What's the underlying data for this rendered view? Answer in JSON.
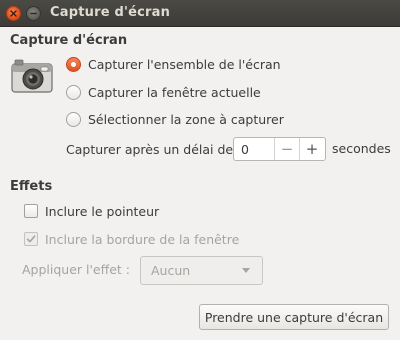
{
  "window": {
    "title": "Capture d'écran",
    "controls": [
      "close-icon",
      "minimize-icon"
    ]
  },
  "capture": {
    "heading": "Capture d'écran",
    "icon": "camera-icon",
    "options": [
      {
        "label": "Capturer l'ensemble de l'écran",
        "selected": true
      },
      {
        "label": "Capturer la fenêtre actuelle",
        "selected": false
      },
      {
        "label": "Sélectionner la zone à capturer",
        "selected": false
      }
    ],
    "delay": {
      "label": "Capturer après un délai de",
      "value": "0",
      "decrement": "−",
      "increment": "+",
      "unit": "secondes"
    }
  },
  "effects": {
    "heading": "Effets",
    "include_pointer": {
      "label": "Inclure le pointeur",
      "checked": false,
      "enabled": true
    },
    "include_border": {
      "label": "Inclure la bordure de la fenêtre",
      "checked": true,
      "enabled": false
    },
    "apply_effect": {
      "label": "Appliquer l'effet :",
      "value": "Aucun",
      "enabled": false
    }
  },
  "actions": {
    "take_screenshot": "Prendre une capture d'écran"
  },
  "colors": {
    "accent": "#e0531e",
    "titlebar": "#3c3b37",
    "window_bg": "#f2f1f0"
  }
}
